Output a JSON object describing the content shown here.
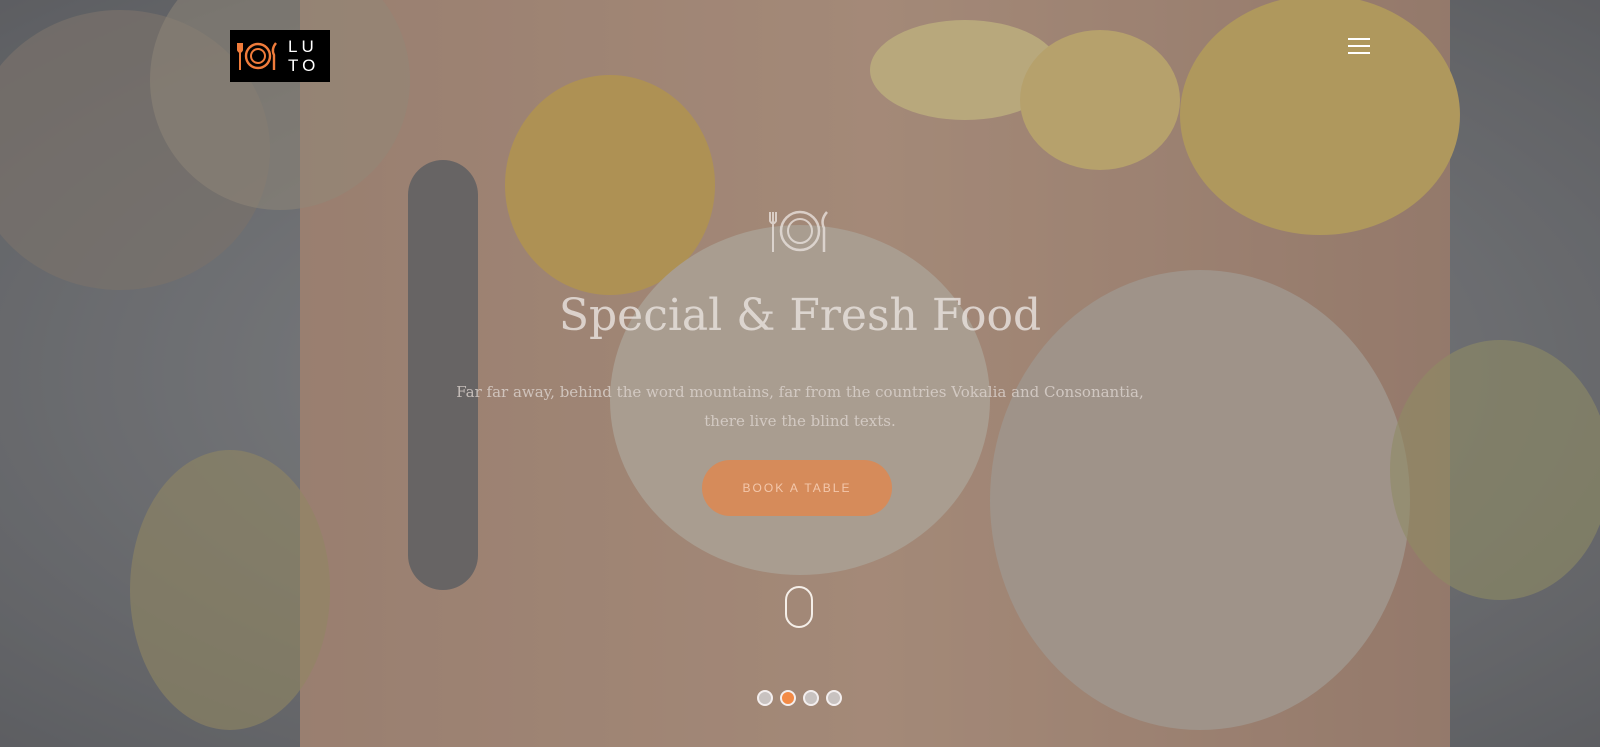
{
  "brand": {
    "logo_text": "LU\nTO",
    "accent": "#f07c3b"
  },
  "header": {
    "menu_icon": "hamburger-menu-icon"
  },
  "hero": {
    "icon": "plate-fork-knife-icon",
    "title": "Special & Fresh Food",
    "lead": "Far far away, behind the word mountains, far from the countries Vokalia and Consonantia, there live the blind texts.",
    "button_label": "BOOK A TABLE",
    "scroll_icon": "mouse-scroll-icon"
  },
  "slider": {
    "slide_count": 4,
    "active_index": 1
  }
}
